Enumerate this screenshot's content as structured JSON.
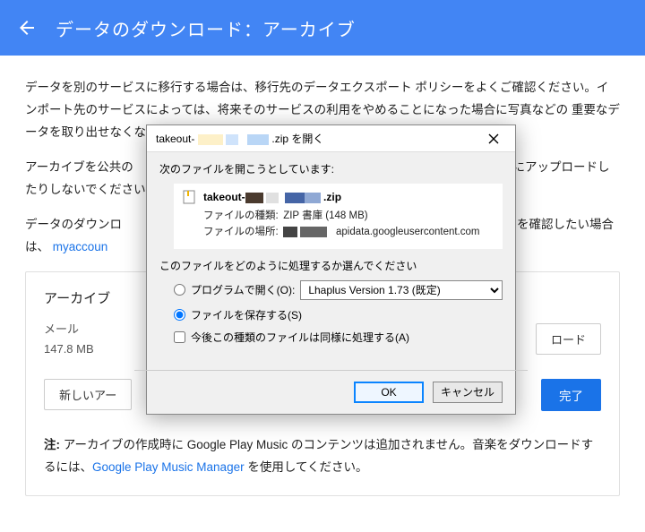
{
  "header": {
    "title": "データのダウンロード：アーカイブ"
  },
  "body": {
    "para1": "データを別のサービスに移行する場合は、移行先のデータエクスポート ポリシーをよくご確認ください。インポート先のサービスによっては、将来そのサービスの利用をやめることになった場合に写真などの 重要なデータを取り出せなくなることがありますのでご注意ください。",
    "para2_a": "アーカイブを公共の",
    "para2_b": "にアップロードしたりしないでください。",
    "para3_a": "データのダウンロ",
    "para3_b": "ンを確認したい場合は、",
    "link_myaccount": "myaccoun",
    "note_prefix": "注:",
    "note_text_a": " アーカイブの作成時に Google Play Music のコンテンツは追加されません。音楽をダウンロードするには、",
    "note_link": "Google Play Music Manager",
    "note_text_b": " を使用してください。"
  },
  "card": {
    "title": "アーカイブ",
    "mail_label": "メール",
    "mail_size": "147.8 MB",
    "download_btn": "ロード",
    "new_btn": "新しいアー",
    "done_btn": "完了"
  },
  "dialog": {
    "title_a": "takeout-",
    "title_b": ".zip を開く",
    "sub": "次のファイルを開こうとしています:",
    "filename_a": "takeout-",
    "filename_b": ".zip",
    "filetype_label": "ファイルの種類:",
    "filetype_value": "ZIP 書庫 (148 MB)",
    "fileloc_label": "ファイルの場所:",
    "fileloc_value": "apidata.googleusercontent.com",
    "question": "このファイルをどのように処理するか選んでください",
    "opt_open": "プログラムで開く(O):",
    "open_selected": "Lhaplus Version 1.73 (既定)",
    "opt_save": "ファイルを保存する(S)",
    "check_future": "今後この種類のファイルは同様に処理する(A)",
    "ok": "OK",
    "cancel": "キャンセル"
  }
}
